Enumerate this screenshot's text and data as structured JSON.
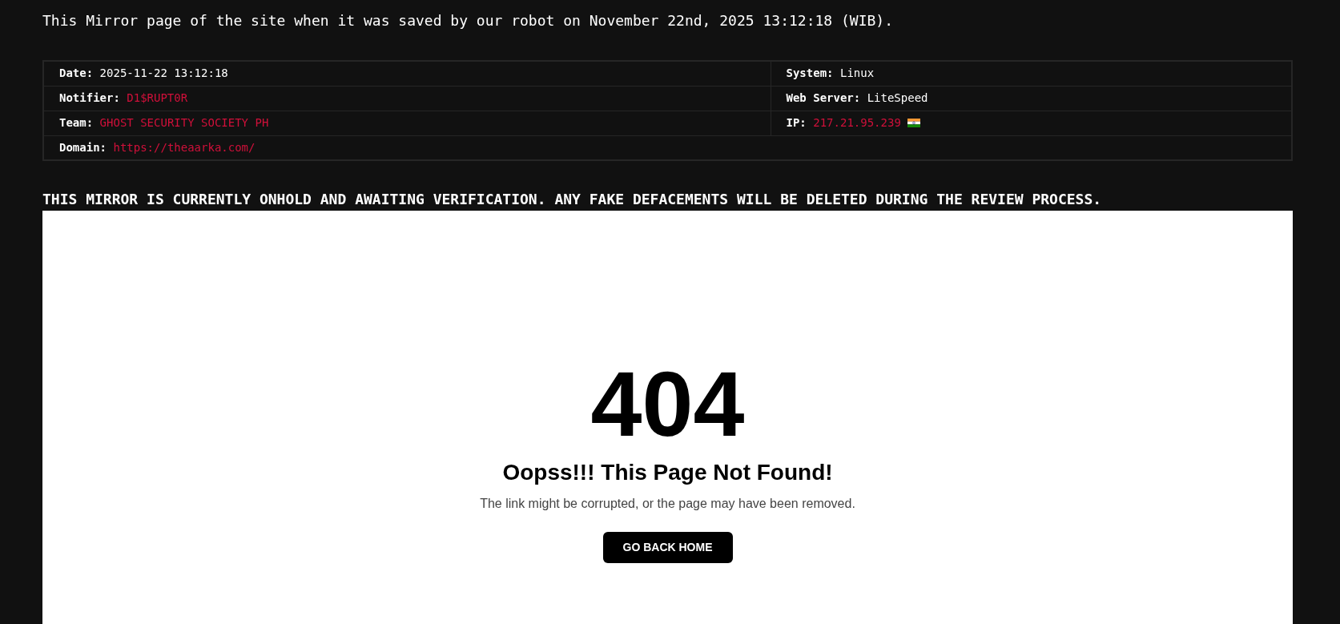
{
  "intro": "This Mirror page of the site when it was saved by our robot on November 22nd, 2025 13:12:18 (WIB).",
  "details": {
    "rows": [
      {
        "cells": [
          {
            "label": "Date:",
            "value": "2025-11-22 13:12:18",
            "kind": "text",
            "flag": false
          },
          {
            "label": "System:",
            "value": "Linux",
            "kind": "text",
            "flag": false
          }
        ]
      },
      {
        "cells": [
          {
            "label": "Notifier:",
            "value": "D1$RUPT0R",
            "kind": "link",
            "flag": false
          },
          {
            "label": "Web Server:",
            "value": "LiteSpeed",
            "kind": "text",
            "flag": false
          }
        ]
      },
      {
        "cells": [
          {
            "label": "Team:",
            "value": "GHOST SECURITY SOCIETY PH",
            "kind": "link",
            "flag": false
          },
          {
            "label": "IP:",
            "value": "217.21.95.239",
            "kind": "link",
            "flag": true
          }
        ]
      },
      {
        "cells": [
          {
            "label": "Domain:",
            "value": "https://theaarka.com/",
            "kind": "link",
            "flag": false,
            "colspan": 2
          }
        ]
      }
    ]
  },
  "notice": "THIS MIRROR IS CURRENTLY ONHOLD AND AWAITING VERIFICATION. ANY FAKE DEFACEMENTS WILL BE DELETED DURING THE REVIEW PROCESS.",
  "page": {
    "code": "404",
    "heading": "Oopss!!! This Page Not Found!",
    "message": "The link might be corrupted, or the page may have been removed.",
    "button": "GO BACK HOME"
  }
}
